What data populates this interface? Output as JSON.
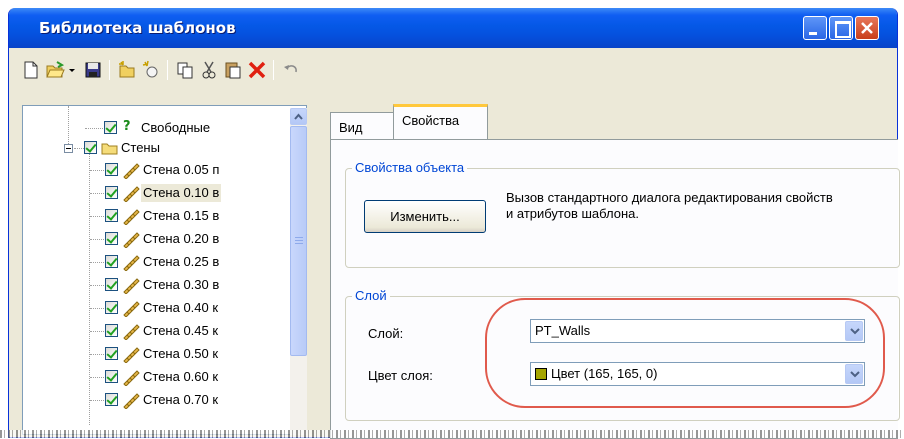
{
  "window": {
    "title": "Библиотека шаблонов"
  },
  "toolbar": {
    "icons": [
      "new-icon",
      "open-icon",
      "dropdown-arrow-icon",
      "save-icon",
      "new-folder-icon",
      "new-template-icon",
      "copy-icon",
      "cut-icon",
      "paste-icon",
      "delete-icon",
      "undo-icon"
    ]
  },
  "tree": {
    "free_label": "Свободные",
    "walls_label": "Стены",
    "items": [
      "Стена 0.05 п",
      "Стена 0.10 в",
      "Стена 0.15 в",
      "Стена 0.20 в",
      "Стена 0.25 в",
      "Стена 0.30 в",
      "Стена 0.40 к",
      "Стена 0.45 к",
      "Стена 0.50 к",
      "Стена 0.60 к",
      "Стена 0.70 к"
    ],
    "selected_index": 1
  },
  "tabs": {
    "view": "Вид",
    "properties": "Свойства"
  },
  "object_props": {
    "title": "Свойства объекта",
    "change_button": "Изменить...",
    "description": "Вызов стандартного диалога редактирования свойств и атрибутов шаблона."
  },
  "layer": {
    "title": "Слой",
    "layer_label": "Слой:",
    "layer_value": "PT_Walls",
    "color_label": "Цвет слоя:",
    "color_value": "Цвет (165, 165, 0)",
    "color_swatch": "#a5a500"
  }
}
